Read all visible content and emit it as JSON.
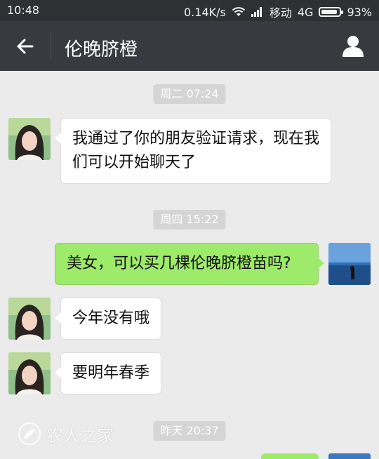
{
  "status_bar": {
    "time": "10:48",
    "speed": "0.14K/s",
    "carrier": "移动",
    "network": "4G",
    "battery": "93%",
    "battery_level": 0.93
  },
  "header": {
    "title": "伦晚脐橙"
  },
  "messages": [
    {
      "type": "timestamp",
      "text": "周二 07:24"
    },
    {
      "type": "received",
      "text": "我通过了你的朋友验证请求，现在我们可以开始聊天了"
    },
    {
      "type": "timestamp",
      "text": "周四 15:22"
    },
    {
      "type": "sent",
      "text": "美女，可以买几棵伦晚脐橙苗吗?"
    },
    {
      "type": "received",
      "text": "今年没有哦"
    },
    {
      "type": "received",
      "text": "要明年春季"
    },
    {
      "type": "timestamp",
      "text": "昨天 20:37"
    }
  ],
  "watermark": {
    "text": "农人之家"
  },
  "colors": {
    "status_bar": "#2e3033",
    "title_bar": "#393a3f",
    "chat_bg": "#ebebeb",
    "sent_bubble": "#9eea6a",
    "received_bubble": "#ffffff"
  }
}
